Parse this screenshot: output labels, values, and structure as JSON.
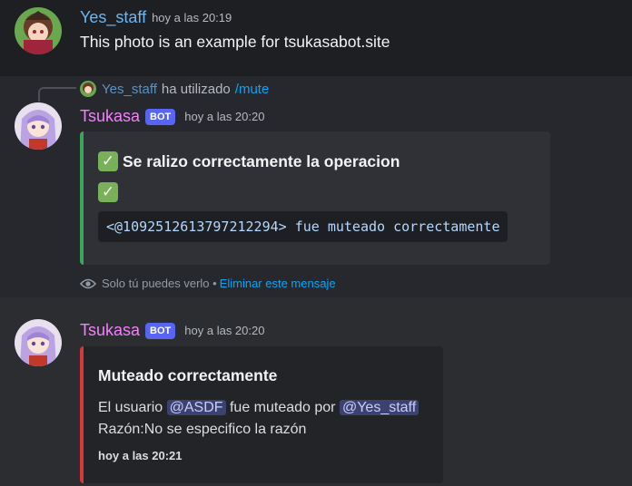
{
  "messages": [
    {
      "author": "Yes_staff",
      "timestamp": "hoy a las 20:19",
      "text": "This photo is an example for tsukasabot.site"
    },
    {
      "reply": {
        "user": "Yes_staff",
        "action": "ha utilizado",
        "command": "/mute"
      },
      "author": "Tsukasa",
      "badge": "BOT",
      "timestamp": "hoy a las 20:20",
      "embed": {
        "title": "Se ralizo correctamente la operacion",
        "code": "<@1092512613797212294> fue muteado correctamente",
        "accent": "#3ba55c"
      },
      "ephemeral": {
        "notice": "Solo tú puedes verlo •",
        "link": "Eliminar este mensaje"
      }
    },
    {
      "author": "Tsukasa",
      "badge": "BOT",
      "timestamp": "hoy a las 20:20",
      "embed": {
        "title": "Muteado correctamente",
        "line1_prefix": "El usuario",
        "mention_user": "@ASDF",
        "line1_middle": "fue muteado por",
        "mention_mod": "@Yes_staff",
        "line2": "Razón:No se especifico la razón",
        "footer": "hoy a las 20:21",
        "accent": "#da373c"
      }
    }
  ],
  "icons": {
    "check": "check-mark-button-icon",
    "eye": "eye-icon"
  },
  "colors": {
    "background": "#1e1f22",
    "staff_name": "#6cb5f1",
    "bot_name": "#f47fff",
    "bot_badge": "#5865f2",
    "link": "#00a8fc"
  }
}
